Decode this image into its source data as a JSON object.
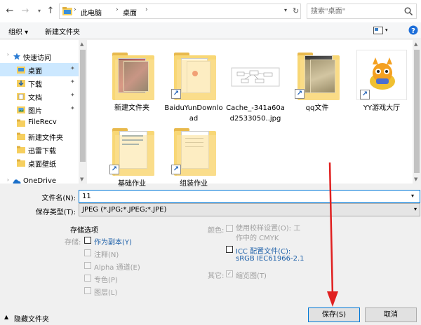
{
  "address": {
    "back_icon": "back-arrow",
    "forward_icon": "forward-arrow",
    "up_icon": "up-arrow",
    "crumbs": [
      "此电脑",
      "桌面"
    ],
    "search_placeholder": "搜索\"桌面\""
  },
  "toolbar": {
    "organize": "组织 ▾",
    "new_folder": "新建文件夹"
  },
  "nav": {
    "items": [
      {
        "label": "快速访问",
        "icon": "star-icon"
      },
      {
        "label": "桌面",
        "icon": "desktop-icon",
        "pinned": true
      },
      {
        "label": "下载",
        "icon": "download-icon",
        "pinned": true
      },
      {
        "label": "文档",
        "icon": "document-icon",
        "pinned": true
      },
      {
        "label": "图片",
        "icon": "picture-icon",
        "pinned": true
      },
      {
        "label": "FileRecv",
        "icon": "folder-icon"
      },
      {
        "label": "新建文件夹",
        "icon": "folder-icon"
      },
      {
        "label": "迅雷下载",
        "icon": "folder-icon"
      },
      {
        "label": "桌面壁纸",
        "icon": "folder-icon"
      },
      {
        "label": "OneDrive",
        "icon": "cloud-icon"
      }
    ]
  },
  "files": {
    "items": [
      {
        "name": "新建文件夹"
      },
      {
        "name": "BaiduYunDownload"
      },
      {
        "name": "Cache_-341a60ad2533050..jpg"
      },
      {
        "name": "qq文件"
      },
      {
        "name": "YY游戏大厅"
      },
      {
        "name": "基础作业"
      },
      {
        "name": "组装作业"
      }
    ]
  },
  "form": {
    "filename_label": "文件名(N):",
    "filename_value": "11",
    "type_label": "保存类型(T):",
    "type_value": "JPEG (*.JPG;*.JPEG;*.JPE)",
    "storage_options_title": "存储选项",
    "storage_label": "存储:",
    "as_copy": "作为副本(Y)",
    "notes": "注释(N)",
    "alpha": "Alpha 通道(E)",
    "spot": "专色(P)",
    "layers": "图层(L)",
    "color_label": "颜色:",
    "use_proof": "使用校样设置(O): 工作中的 CMYK",
    "icc_line1": "ICC 配置文件(C):",
    "icc_line2": "sRGB IEC61966-2.1",
    "other_label": "其它:",
    "thumbnail": "缩览图(T)",
    "hide_folders": "隐藏文件夹",
    "save": "保存(S)",
    "cancel": "取消"
  },
  "colors": {
    "accent": "#0078d7",
    "annotation_red": "#e02020"
  }
}
